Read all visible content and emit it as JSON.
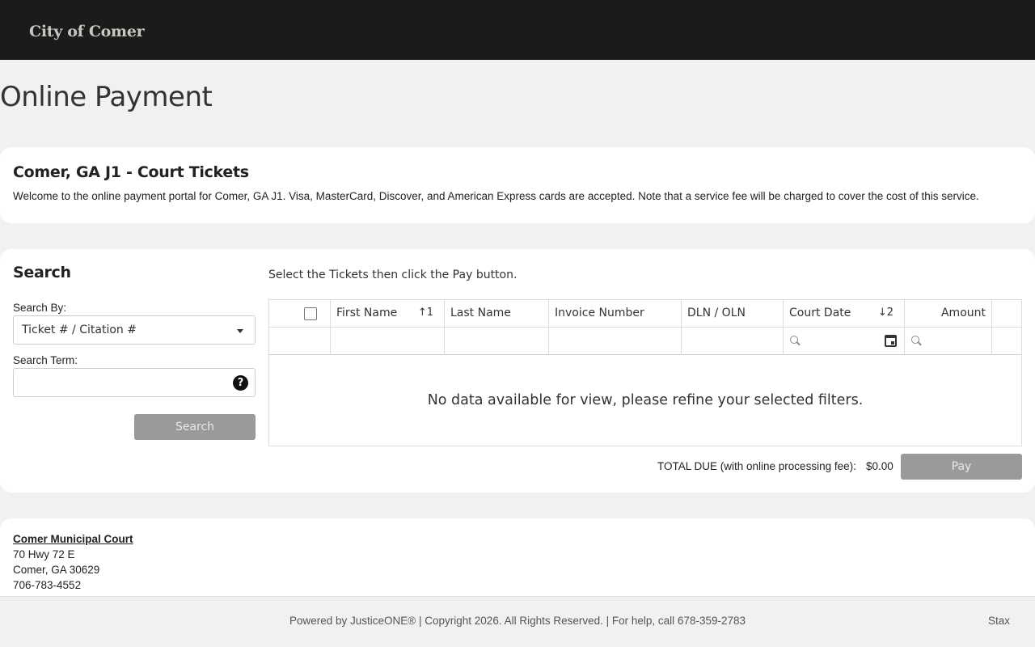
{
  "header": {
    "brand": "City of Comer"
  },
  "page_title": "Online Payment",
  "intro": {
    "title": "Comer, GA J1 - Court Tickets",
    "text": "Welcome to the online payment portal for Comer, GA J1. Visa, MasterCard, Discover, and American Express cards are accepted. Note that a service fee will be charged to cover the cost of this service."
  },
  "search": {
    "title": "Search",
    "search_by_label": "Search By:",
    "search_by_value": "Ticket # / Citation #",
    "search_term_label": "Search Term:",
    "search_term_value": "",
    "help_icon": "question-circle-icon",
    "button_label": "Search"
  },
  "grid": {
    "instructions": "Select the Tickets then click the Pay button.",
    "columns": [
      {
        "label": ""
      },
      {
        "label": "First Name",
        "sort": "↑1"
      },
      {
        "label": "Last Name"
      },
      {
        "label": "Invoice Number"
      },
      {
        "label": "DLN / OLN"
      },
      {
        "label": "Court Date",
        "sort": "↓2"
      },
      {
        "label": "Amount"
      }
    ],
    "empty_message": "No data available for view, please refine your selected filters."
  },
  "totals": {
    "label": "TOTAL DUE (with online processing fee):",
    "value": "$0.00",
    "pay_label": "Pay"
  },
  "court": {
    "name": "Comer Municipal Court",
    "address_line1": "70 Hwy 72 E",
    "address_line2": "Comer, GA 30629",
    "phone": "706-783-4552"
  },
  "footer": {
    "text": "Powered by JusticeONE® | Copyright 2026. All Rights Reserved. | For help, call 678-359-2783",
    "stax": "Stax"
  },
  "colors": {
    "topbar": "#1b1b1b",
    "page_bg": "#f1f1f1",
    "button_disabled": "#9a9a9a"
  }
}
